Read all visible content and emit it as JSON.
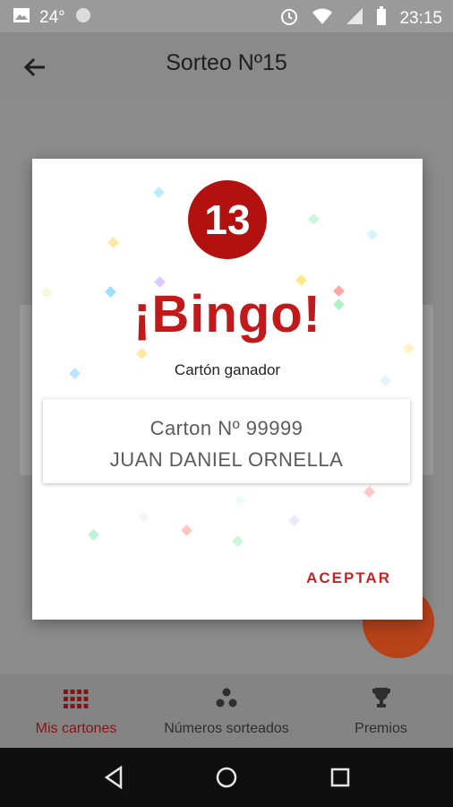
{
  "status_bar": {
    "temperature": "24°",
    "time": "23:15"
  },
  "app_bar": {
    "title": "Sorteo Nº15"
  },
  "dialog": {
    "ball_number": "13",
    "title": "¡Bingo!",
    "subtitle": "Cartón ganador",
    "card_number": "Carton Nº 99999",
    "card_owner": "JUAN DANIEL ORNELLA",
    "accept_label": "ACEPTAR"
  },
  "bottom_nav": {
    "items": [
      {
        "label": "Mis cartones",
        "icon": "grid-icon",
        "selected": true
      },
      {
        "label": "Números sorteados",
        "icon": "balls-icon",
        "selected": false
      },
      {
        "label": "Premios",
        "icon": "trophy-icon",
        "selected": false
      }
    ]
  },
  "colors": {
    "accent": "#c62424",
    "ball": "#b31010",
    "fab": "#b6421a"
  }
}
